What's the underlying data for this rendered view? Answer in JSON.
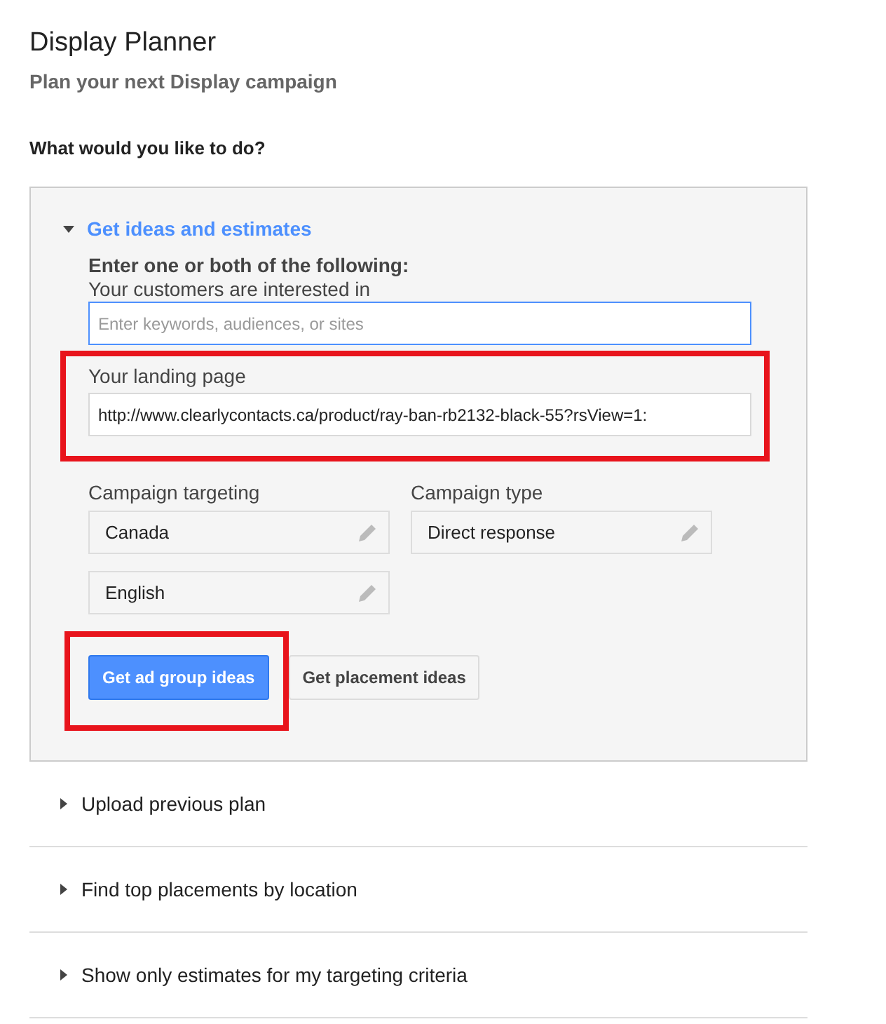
{
  "title": "Display Planner",
  "subtitle": "Plan your next Display campaign",
  "question": "What would you like to do?",
  "sections": [
    {
      "label": "Get ideas and estimates",
      "expanded": true
    },
    {
      "label": "Upload previous plan",
      "expanded": false
    },
    {
      "label": "Find top placements by location",
      "expanded": false
    },
    {
      "label": "Show only estimates for my targeting criteria",
      "expanded": false
    }
  ],
  "form": {
    "instruction": "Enter one or both of the following:",
    "interests": {
      "label": "Your customers are interested in",
      "placeholder": "Enter keywords, audiences, or sites"
    },
    "landing": {
      "label": "Your landing page",
      "value": "http://www.clearlycontacts.ca/product/ray-ban-rb2132-black-55?rsView=1:",
      "highlighted": true
    },
    "targeting": {
      "label": "Campaign targeting",
      "values": [
        "Canada",
        "English"
      ]
    },
    "type": {
      "label": "Campaign type",
      "value": "Direct response"
    },
    "buttons": [
      {
        "label": "Get ad group ideas",
        "kind": "primary",
        "highlighted": true
      },
      {
        "label": "Get placement ideas",
        "kind": "secondary",
        "highlighted": false
      }
    ]
  }
}
